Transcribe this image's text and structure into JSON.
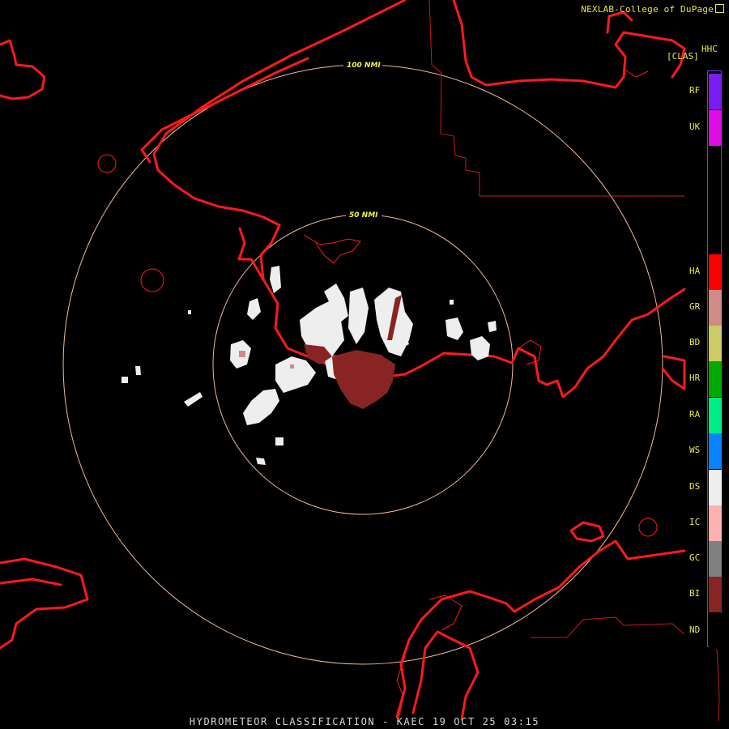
{
  "header": {
    "credit": "NEXLAB-College of DuPage",
    "product_code": "HHC",
    "product_class": "[CLAS]"
  },
  "footer": {
    "title": "HYDROMETEOR CLASSIFICATION - KAEC 19 OCT 25 03:15"
  },
  "range_rings": [
    {
      "label": "100 NMI"
    },
    {
      "label": "50 NMI"
    }
  ],
  "legend": {
    "border_color": "#6a3df0",
    "items": [
      {
        "code": "RF",
        "color": "#7a1cf0"
      },
      {
        "code": "UK",
        "color": "#e00ce6"
      },
      {
        "code": "HA",
        "color": "#ff0000"
      },
      {
        "code": "GR",
        "color": "#d08a88"
      },
      {
        "code": "BD",
        "color": "#cccc66"
      },
      {
        "code": "HR",
        "color": "#00aa00"
      },
      {
        "code": "RA",
        "color": "#00ee88"
      },
      {
        "code": "WS",
        "color": "#0a82ff"
      },
      {
        "code": "DS",
        "color": "#eeeeee"
      },
      {
        "code": "IC",
        "color": "#ffb0b0"
      },
      {
        "code": "GC",
        "color": "#808080"
      },
      {
        "code": "BI",
        "color": "#882424"
      },
      {
        "code": "ND",
        "color": "#000000"
      }
    ]
  },
  "map_colors": {
    "coastline": "#ff1a1a",
    "border": "#cc1a1a",
    "rings": "#f0b89a",
    "echo_dry_snow": "#eeeeee",
    "echo_biological": "#882424",
    "echo_graupel": "#d08a88"
  }
}
